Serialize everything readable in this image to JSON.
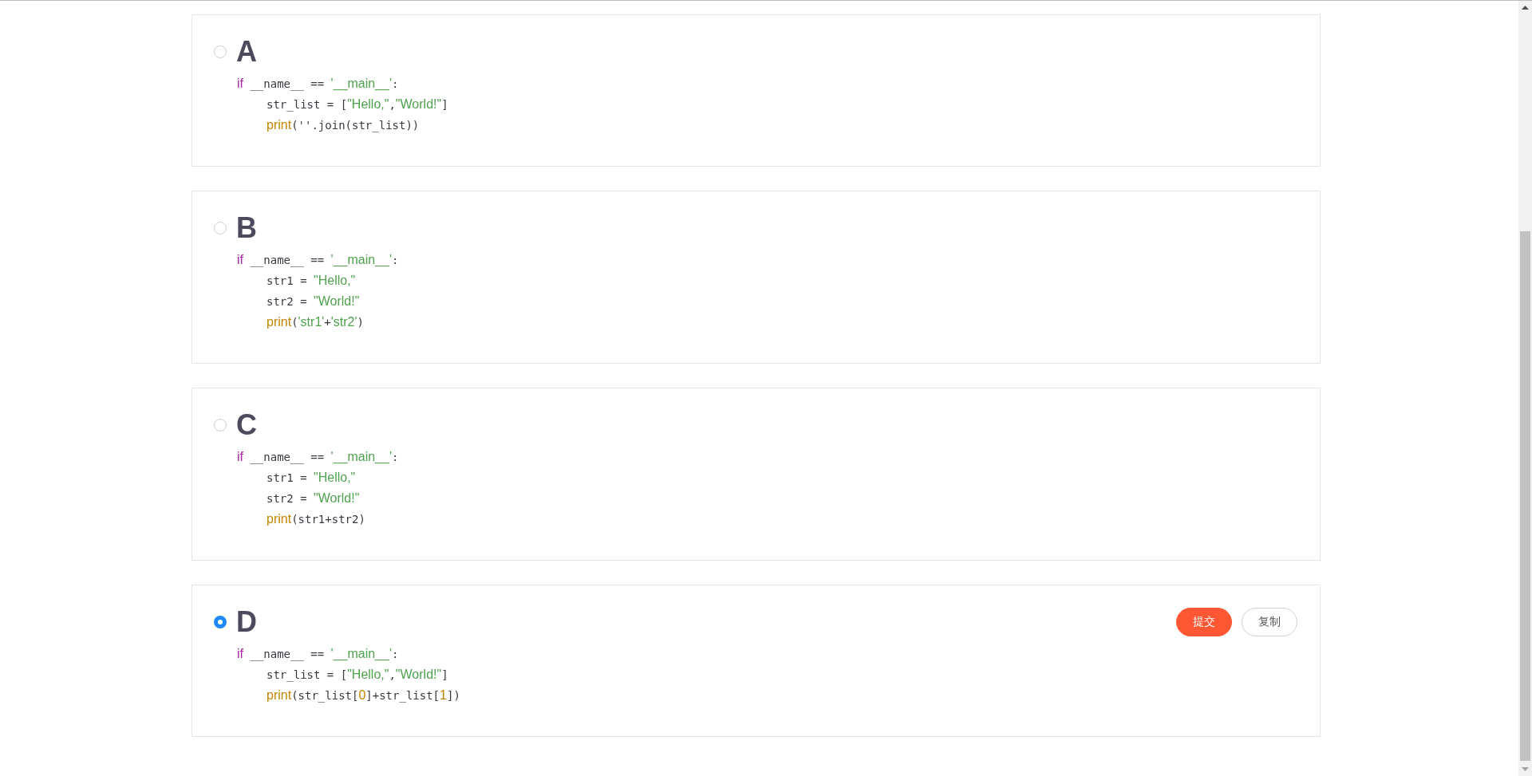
{
  "options": [
    {
      "letter": "A",
      "selected": false,
      "code": [
        {
          "indented": false,
          "tokens": [
            {
              "kind": "keyword",
              "text": "if"
            },
            {
              "kind": "plain",
              "text": " __name__ == "
            },
            {
              "kind": "string",
              "text": "'__main__'"
            },
            {
              "kind": "plain",
              "text": ":"
            }
          ]
        },
        {
          "indented": true,
          "tokens": [
            {
              "kind": "plain",
              "text": "str_list = ["
            },
            {
              "kind": "string",
              "text": "\"Hello,\""
            },
            {
              "kind": "plain",
              "text": ","
            },
            {
              "kind": "string",
              "text": "\"World!\""
            },
            {
              "kind": "plain",
              "text": "]"
            }
          ]
        },
        {
          "indented": true,
          "tokens": [
            {
              "kind": "builtin",
              "text": "print"
            },
            {
              "kind": "plain",
              "text": "('"
            },
            {
              "kind": "plain",
              "text": "'.join(str_list))"
            }
          ]
        }
      ]
    },
    {
      "letter": "B",
      "selected": false,
      "code": [
        {
          "indented": false,
          "tokens": [
            {
              "kind": "keyword",
              "text": "if"
            },
            {
              "kind": "plain",
              "text": " __name__ == "
            },
            {
              "kind": "string",
              "text": "'__main__'"
            },
            {
              "kind": "plain",
              "text": ":"
            }
          ]
        },
        {
          "indented": true,
          "tokens": [
            {
              "kind": "plain",
              "text": "str1 = "
            },
            {
              "kind": "string",
              "text": "\"Hello,\""
            }
          ]
        },
        {
          "indented": true,
          "tokens": [
            {
              "kind": "plain",
              "text": "str2 = "
            },
            {
              "kind": "string",
              "text": "\"World!\""
            }
          ]
        },
        {
          "indented": true,
          "tokens": [
            {
              "kind": "builtin",
              "text": "print"
            },
            {
              "kind": "plain",
              "text": "("
            },
            {
              "kind": "string",
              "text": "'str1'"
            },
            {
              "kind": "plain",
              "text": "+"
            },
            {
              "kind": "string",
              "text": "'str2'"
            },
            {
              "kind": "plain",
              "text": ")"
            }
          ]
        }
      ]
    },
    {
      "letter": "C",
      "selected": false,
      "code": [
        {
          "indented": false,
          "tokens": [
            {
              "kind": "keyword",
              "text": "if"
            },
            {
              "kind": "plain",
              "text": " __name__ == "
            },
            {
              "kind": "string",
              "text": "'__main__'"
            },
            {
              "kind": "plain",
              "text": ":"
            }
          ]
        },
        {
          "indented": true,
          "tokens": [
            {
              "kind": "plain",
              "text": "str1 = "
            },
            {
              "kind": "string",
              "text": "\"Hello,\""
            }
          ]
        },
        {
          "indented": true,
          "tokens": [
            {
              "kind": "plain",
              "text": "str2 = "
            },
            {
              "kind": "string",
              "text": "\"World!\""
            }
          ]
        },
        {
          "indented": true,
          "tokens": [
            {
              "kind": "builtin",
              "text": "print"
            },
            {
              "kind": "plain",
              "text": "(str1+str2)"
            }
          ]
        }
      ]
    },
    {
      "letter": "D",
      "selected": true,
      "buttons": [
        {
          "label": "提交",
          "kind": "primary"
        },
        {
          "label": "复制",
          "kind": "secondary"
        }
      ],
      "code": [
        {
          "indented": false,
          "tokens": [
            {
              "kind": "keyword",
              "text": "if"
            },
            {
              "kind": "plain",
              "text": " __name__ == "
            },
            {
              "kind": "string",
              "text": "'__main__'"
            },
            {
              "kind": "plain",
              "text": ":"
            }
          ]
        },
        {
          "indented": true,
          "tokens": [
            {
              "kind": "plain",
              "text": "str_list = ["
            },
            {
              "kind": "string",
              "text": "\"Hello,\""
            },
            {
              "kind": "plain",
              "text": ","
            },
            {
              "kind": "string",
              "text": "\"World!\""
            },
            {
              "kind": "plain",
              "text": "]"
            }
          ]
        },
        {
          "indented": true,
          "tokens": [
            {
              "kind": "builtin",
              "text": "print"
            },
            {
              "kind": "plain",
              "text": "(str_list["
            },
            {
              "kind": "number",
              "text": "0"
            },
            {
              "kind": "plain",
              "text": "]+str_list["
            },
            {
              "kind": "number",
              "text": "1"
            },
            {
              "kind": "plain",
              "text": "])"
            }
          ]
        }
      ]
    }
  ]
}
